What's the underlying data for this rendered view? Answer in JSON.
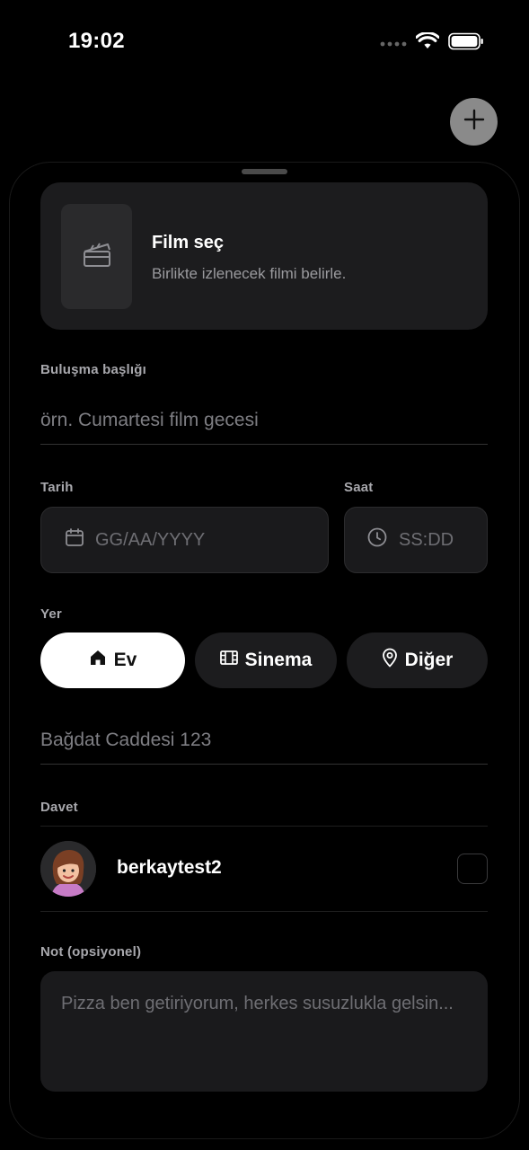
{
  "status_bar": {
    "time": "19:02"
  },
  "background": {
    "add_icon": "plus-icon"
  },
  "film_card": {
    "title": "Film seç",
    "subtitle": "Birlikte izlenecek filmi belirle.",
    "icon": "clapperboard-icon"
  },
  "title_field": {
    "label": "Buluşma başlığı",
    "placeholder": "örn. Cumartesi film gecesi"
  },
  "date_field": {
    "label": "Tarih",
    "placeholder": "GG/AA/YYYY",
    "icon": "calendar-icon"
  },
  "time_field": {
    "label": "Saat",
    "placeholder": "SS:DD",
    "icon": "clock-icon"
  },
  "location": {
    "label": "Yer",
    "options": [
      {
        "label": "Ev",
        "icon": "home-icon",
        "selected": true
      },
      {
        "label": "Sinema",
        "icon": "film-icon",
        "selected": false
      },
      {
        "label": "Diğer",
        "icon": "map-pin-icon",
        "selected": false
      }
    ],
    "address_placeholder": "Bağdat Caddesi 123"
  },
  "invite": {
    "label": "Davet",
    "users": [
      {
        "username": "berkaytest2",
        "checked": false
      }
    ]
  },
  "note": {
    "label": "Not (opsiyonel)",
    "placeholder": "Pizza ben getiriyorum, herkes susuzlukla gelsin..."
  },
  "colors": {
    "background": "#000000",
    "card": "#1c1c1e",
    "selected_chip": "#ffffff"
  }
}
